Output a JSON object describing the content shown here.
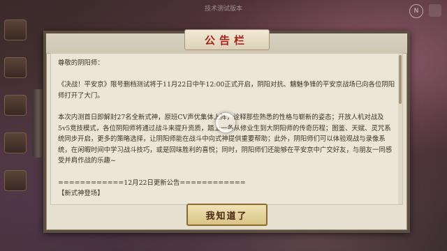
{
  "top_bar": {
    "text": "技术测试版本"
  },
  "top_right_icon": "N",
  "panel": {
    "title": "公告栏",
    "content": {
      "greeting": "尊敬的阴阳师：",
      "paragraph1": "《决战！平安京》限号删档测试将于11月22日中午12:00正式开启，阴阳对抗、魑魅争锋的平安京战场已向各位阴阳师打开了大门。",
      "paragraph2": "本次内测首日即解封27名全新式神，原班CV声优集体上阵，诠释那些熟悉的性格与崭新的姿态；开放人机对战及5v5竞技模式，各位阴阳师将通过战斗来提升资质，踏上一条从修业生到大阴阳师的传奇历程；图鉴、天赋、灵咒系统同步开启，更多的策略选择，让阴阳师能在战斗中向式神提供重要帮助；此外，阴阳师们可以体验观战与录像系统，在闲暇时间中学习战斗技巧，或是回味胜利的喜悦；同时，阴阳师们还能够在平安京中广交好友，与朋友一同感受并肩作战的乐趣~",
      "update_header": "============12月22日更新公告============",
      "section_title": "【新式神登场】"
    },
    "confirm_label": "我知道了"
  }
}
